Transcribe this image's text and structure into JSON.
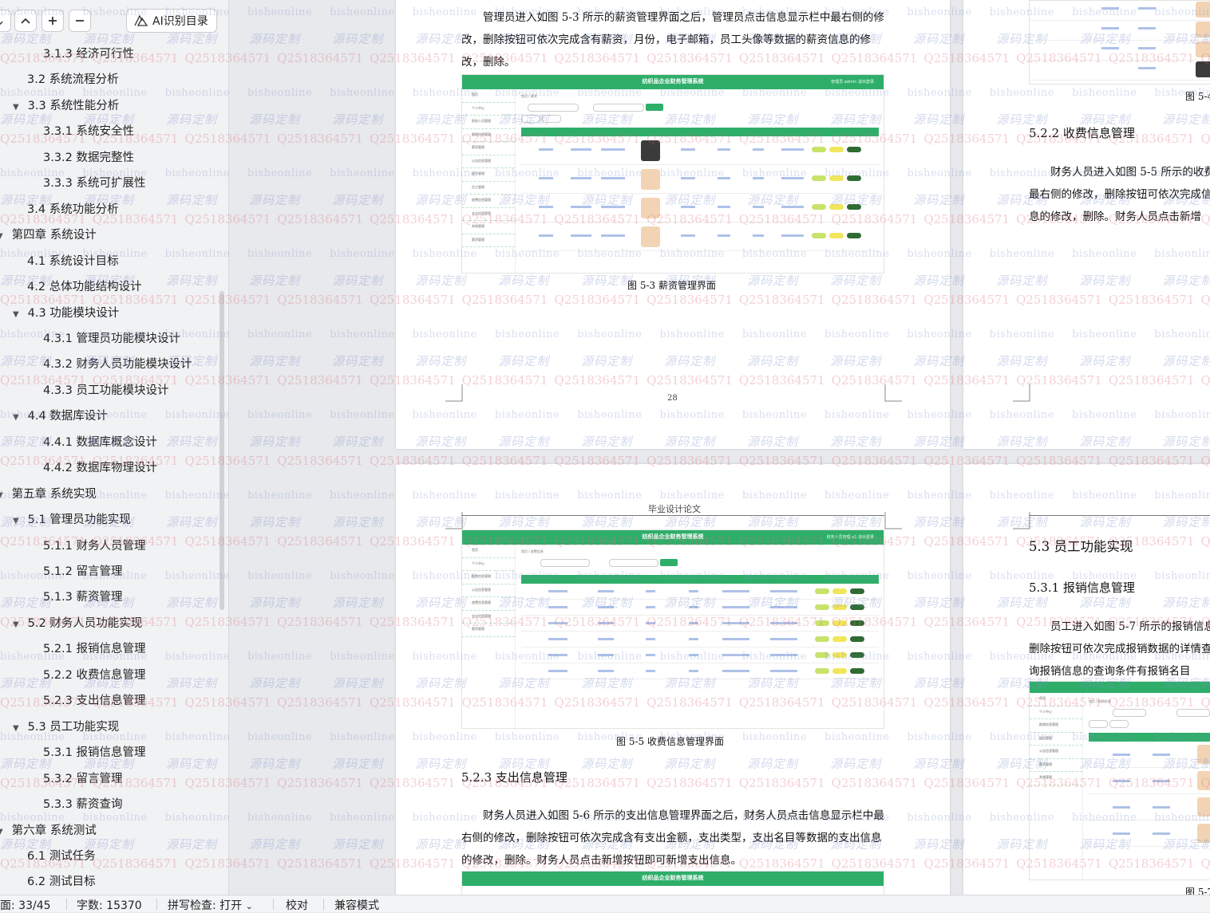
{
  "outline": {
    "toolbar": {
      "ai_label": "AI识别目录"
    },
    "items": [
      {
        "label": "3.1.3 经济可行性",
        "level": 3,
        "caret": ""
      },
      {
        "label": "3.2 系统流程分析",
        "level": 2,
        "caret": ""
      },
      {
        "label": "3.3 系统性能分析",
        "level": 2,
        "caret": "▼"
      },
      {
        "label": "3.3.1 系统安全性",
        "level": 3,
        "caret": ""
      },
      {
        "label": "3.3.2 数据完整性",
        "level": 3,
        "caret": ""
      },
      {
        "label": "3.3.3 系统可扩展性",
        "level": 3,
        "caret": ""
      },
      {
        "label": "3.4 系统功能分析",
        "level": 2,
        "caret": ""
      },
      {
        "label": "第四章  系统设计",
        "level": 1,
        "caret": "▼"
      },
      {
        "label": "4.1  系统设计目标",
        "level": 2,
        "caret": ""
      },
      {
        "label": "4.2  总体功能结构设计",
        "level": 2,
        "caret": ""
      },
      {
        "label": "4.3  功能模块设计",
        "level": 2,
        "caret": "▼"
      },
      {
        "label": "4.3.1  管理员功能模块设计",
        "level": 3,
        "caret": ""
      },
      {
        "label": "4.3.2  财务人员功能模块设计",
        "level": 3,
        "caret": ""
      },
      {
        "label": "4.3.3  员工功能模块设计",
        "level": 3,
        "caret": ""
      },
      {
        "label": "4.4  数据库设计",
        "level": 2,
        "caret": "▼"
      },
      {
        "label": "4.4.1  数据库概念设计",
        "level": 3,
        "caret": ""
      },
      {
        "label": "4.4.2  数据库物理设计",
        "level": 3,
        "caret": ""
      },
      {
        "label": "第五章  系统实现",
        "level": 1,
        "caret": "▼"
      },
      {
        "label": "5.1 管理员功能实现",
        "level": 2,
        "caret": "▼"
      },
      {
        "label": "5.1.1  财务人员管理",
        "level": 3,
        "caret": ""
      },
      {
        "label": "5.1.2  留言管理",
        "level": 3,
        "caret": ""
      },
      {
        "label": "5.1.3  薪资管理",
        "level": 3,
        "caret": "",
        "selected": true
      },
      {
        "label": "5.2  财务人员功能实现",
        "level": 2,
        "caret": "▼"
      },
      {
        "label": "5.2.1  报销信息管理",
        "level": 3,
        "caret": ""
      },
      {
        "label": "5.2.2  收费信息管理",
        "level": 3,
        "caret": ""
      },
      {
        "label": "5.2.3  支出信息管理",
        "level": 3,
        "caret": ""
      },
      {
        "label": "5.3  员工功能实现",
        "level": 2,
        "caret": "▼"
      },
      {
        "label": "5.3.1  报销信息管理",
        "level": 3,
        "caret": ""
      },
      {
        "label": "5.3.2  留言管理",
        "level": 3,
        "caret": ""
      },
      {
        "label": "5.3.3  薪资查询",
        "level": 3,
        "caret": ""
      },
      {
        "label": "第六章  系统测试",
        "level": 1,
        "caret": "▼"
      },
      {
        "label": "6.1  测试任务",
        "level": 2,
        "caret": ""
      },
      {
        "label": "6.2  测试目标",
        "level": 2,
        "caret": ""
      }
    ]
  },
  "pages": {
    "p28": {
      "para": "管理员进入如图 5-3 所示的薪资管理界面之后，管理员点击信息显示栏中最右侧的修改，删除按钮可依次完成含有薪资，月份，电子邮箱，员工头像等数据的薪资信息的修改，删除。",
      "caption": "图 5-3  薪资管理界面",
      "page_number": "28",
      "shot_title": "纺织品企业财务管理系统"
    },
    "p28r": {
      "caption_partial": "图 5-4",
      "heading": "5.2.2  收费信息管理",
      "para": "财务人员进入如图 5-5 所示的收费最右侧的修改，删除按钮可依次完成信息的修改，删除。财务人员点击新增"
    },
    "p29": {
      "header": "毕业设计论文",
      "caption": "图 5-5  收费信息管理界面",
      "heading": "5.2.3  支出信息管理",
      "para": "财务人员进入如图 5-6 所示的支出信息管理界面之后，财务人员点击信息显示栏中最右侧的修改，删除按钮可依次完成含有支出金额，支出类型，支出名目等数据的支出信息的修改，删除。财务人员点击新增按钮即可新增支出信息。",
      "shot_title": "纺织品企业财务管理系统"
    },
    "p29r": {
      "heading_big": "5.3  员工功能实现",
      "heading": "5.3.1  报销信息管理",
      "para": "员工进入如图 5-7 所示的报销信息删除按钮可依次完成报销数据的详情查询报销信息的查询条件有报销名目",
      "caption_partial": "图 5-7"
    }
  },
  "watermark": {
    "site": "bisheonline",
    "brand": "源码定制",
    "qq": "Q2518364571"
  },
  "status": {
    "page": "面: 33/45",
    "words": "字数: 15370",
    "spell": "拼写检查: 打开",
    "proof": "校对",
    "compat": "兼容模式"
  },
  "colors": {
    "accent_green": "#2fae6a",
    "watermark_blue": "#8296c8",
    "watermark_red": "#dc6e78"
  }
}
